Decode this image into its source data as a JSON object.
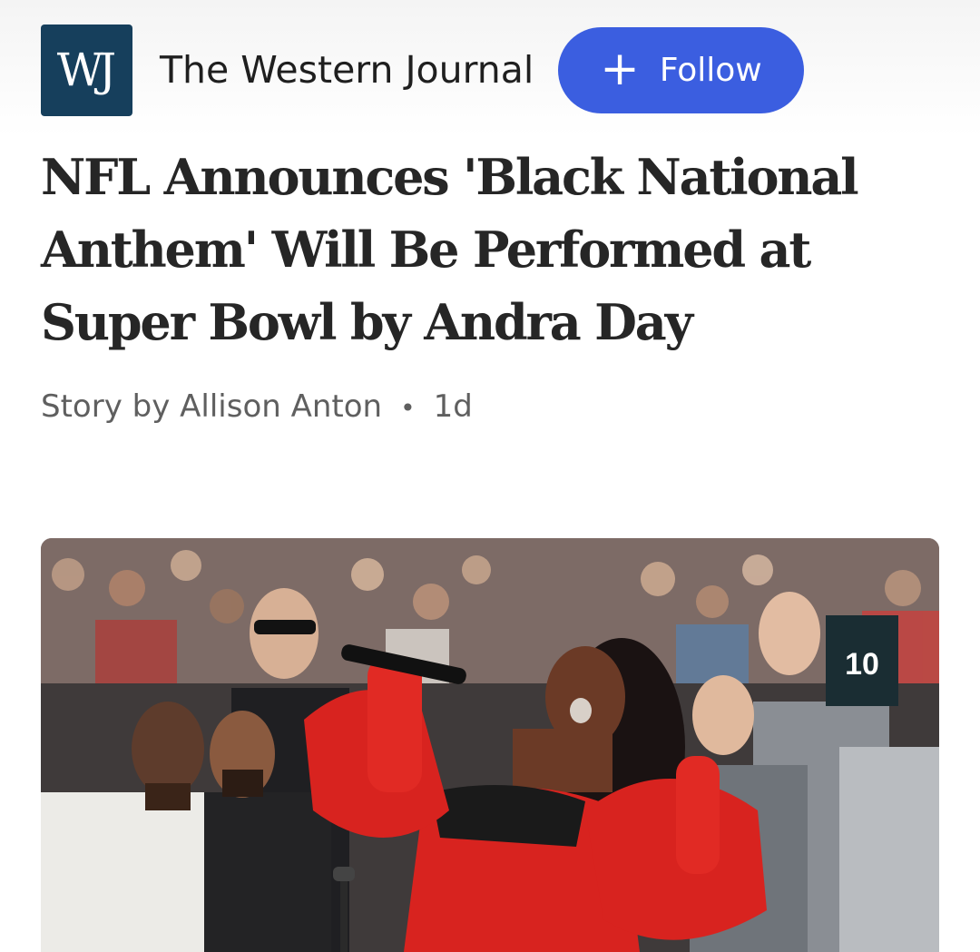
{
  "publisher": {
    "logo_text": "WJ",
    "name": "The Western Journal",
    "follow_icon": "plus-icon",
    "follow_label": "Follow"
  },
  "article": {
    "headline": "NFL Announces 'Black National Anthem' Will Be Performed at Super Bowl by Andra Day",
    "byline": "Story by Allison Anton",
    "separator": "•",
    "age": "1d"
  },
  "hero_image": {
    "jersey_number": "10"
  },
  "colors": {
    "logo_bg": "#163f5c",
    "follow_bg": "#3b5ee0",
    "headline": "#262626",
    "byline": "#5f5f5f",
    "dress_red": "#d8231f"
  }
}
